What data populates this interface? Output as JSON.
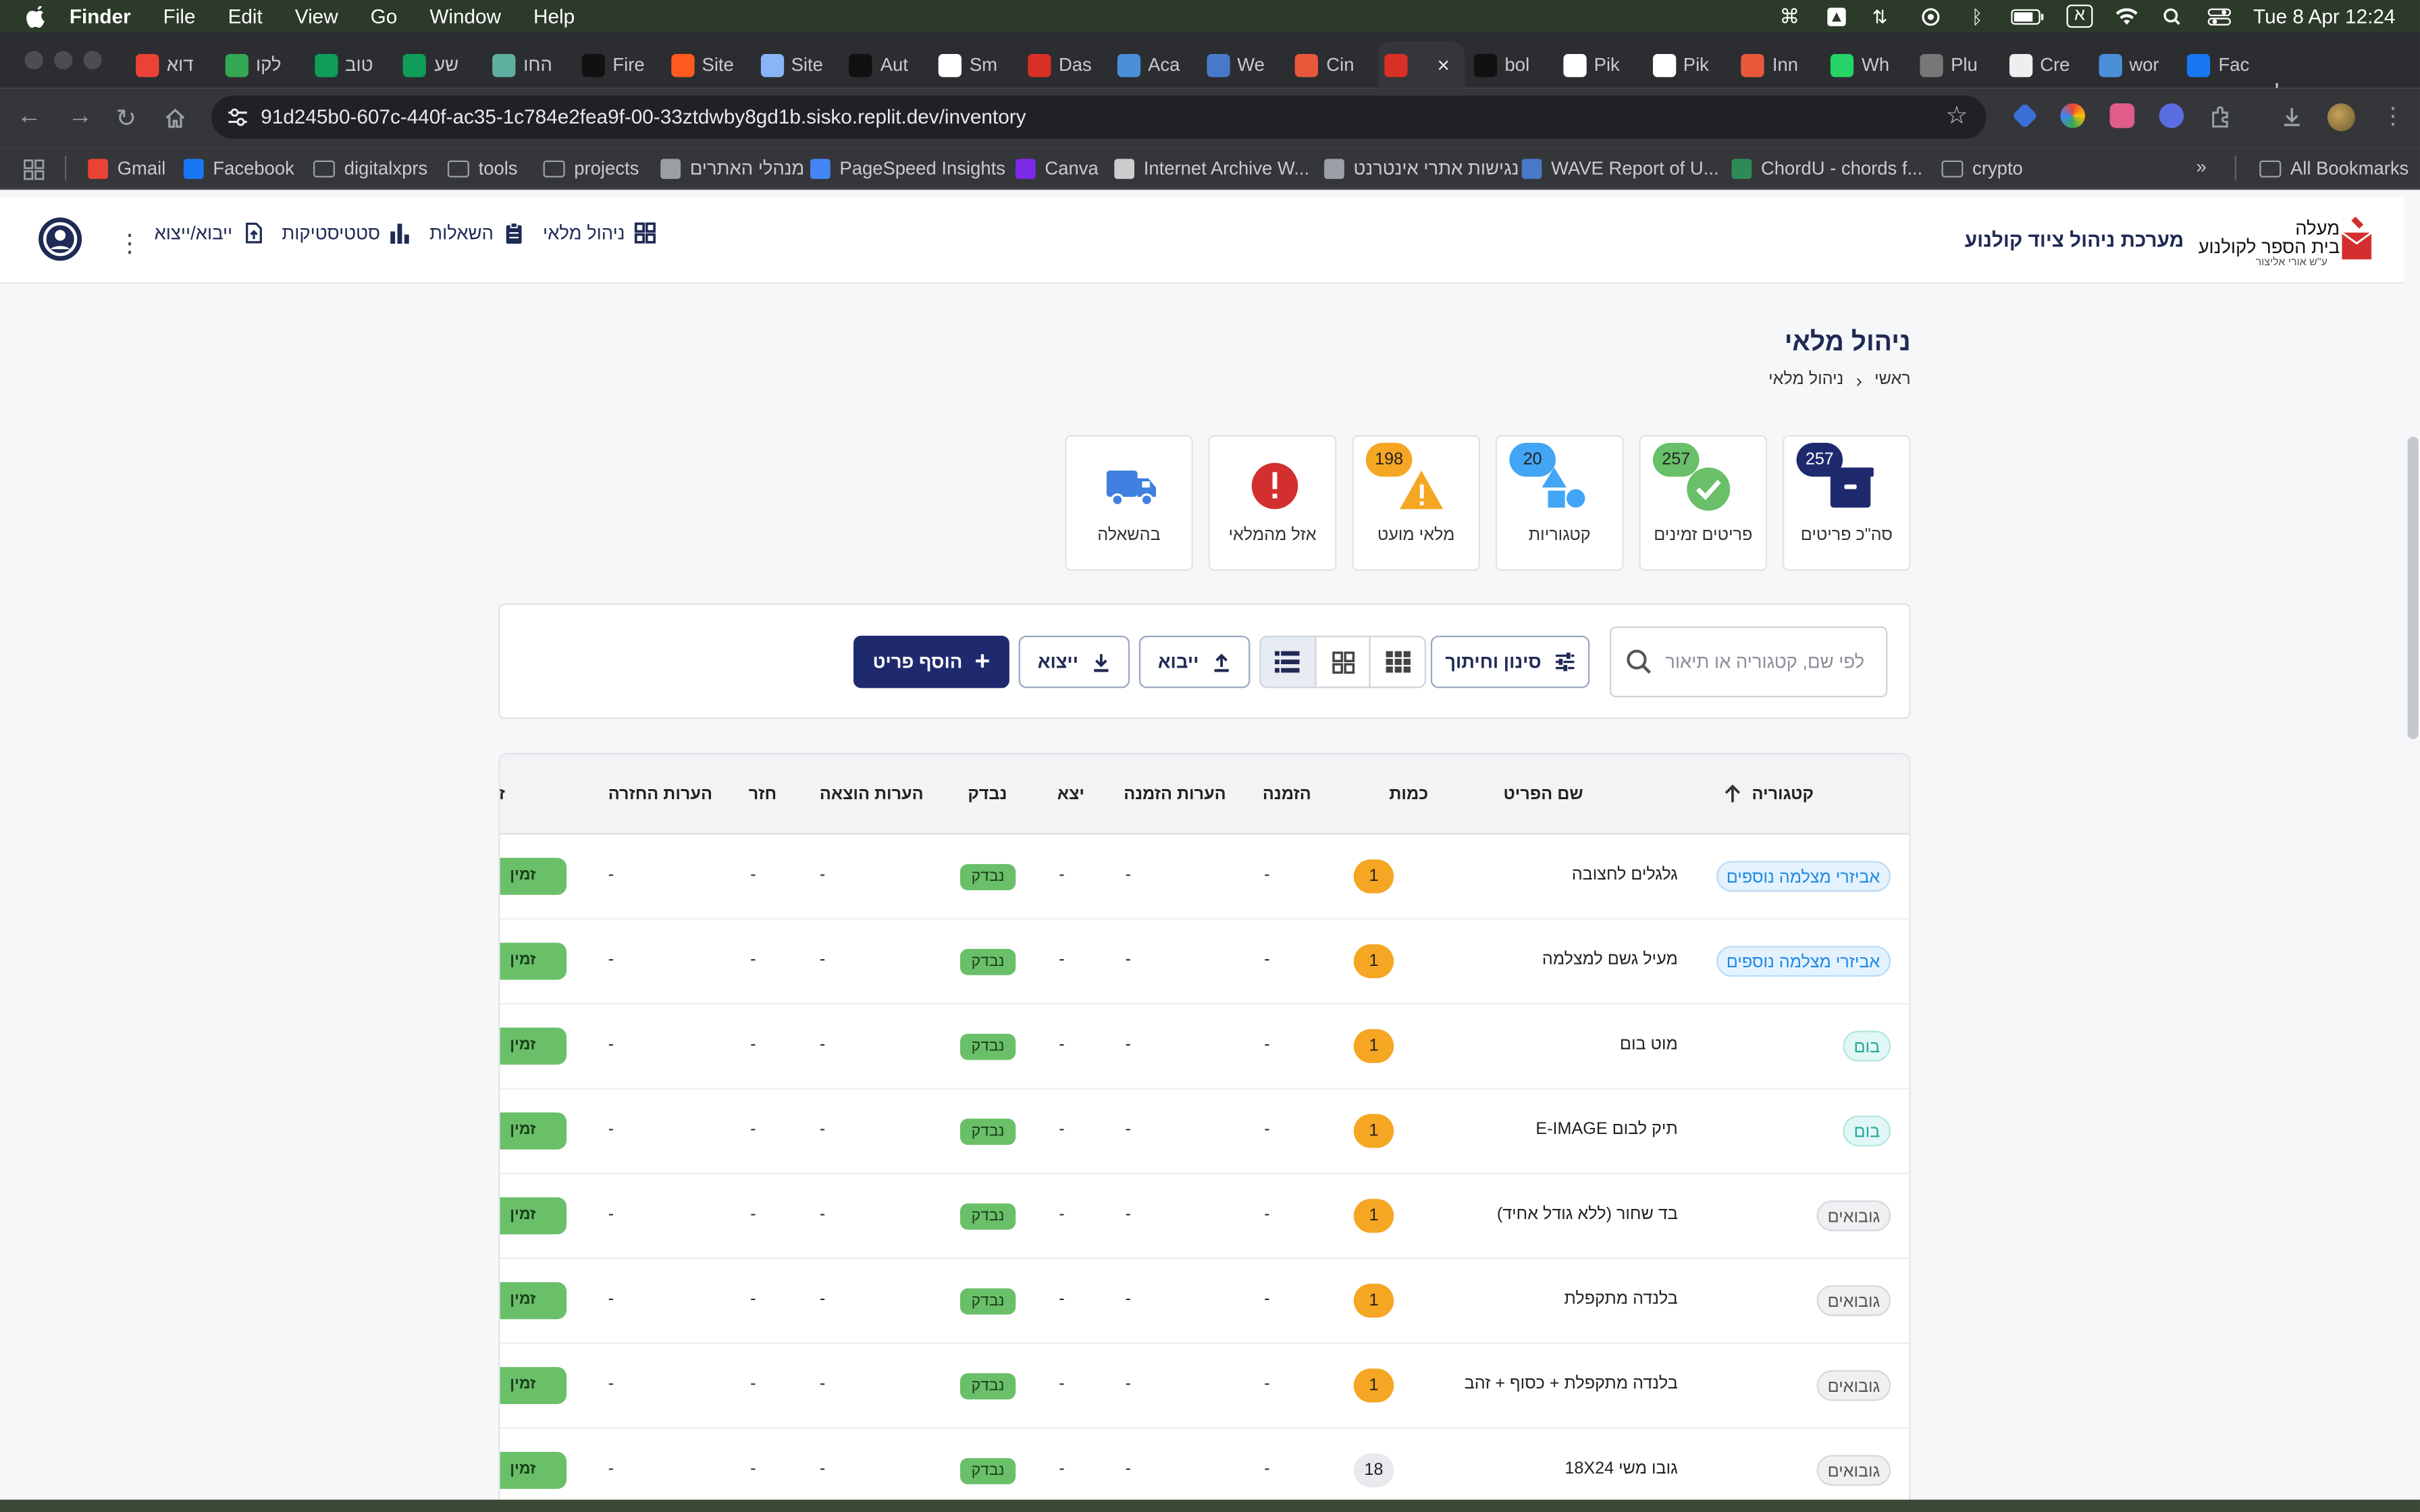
{
  "menubar": {
    "app": "Finder",
    "items": [
      "File",
      "Edit",
      "View",
      "Go",
      "Window",
      "Help"
    ],
    "clock": "Tue 8 Apr  12:24",
    "input_lang": "א"
  },
  "tabs": [
    {
      "label": "דוא",
      "color": "#ea4335"
    },
    {
      "label": "לקו",
      "color": "#34a853"
    },
    {
      "label": "טוב",
      "color": "#0f9d58"
    },
    {
      "label": "שע",
      "color": "#0f9d58"
    },
    {
      "label": "החו",
      "color": "#5fb0a0"
    },
    {
      "label": "Fire",
      "color": "#111111"
    },
    {
      "label": "Site",
      "color": "#ff5a1f"
    },
    {
      "label": "Site",
      "color": "#8ab4f8"
    },
    {
      "label": "Aut",
      "color": "#111111"
    },
    {
      "label": "Sm",
      "color": "#ffffff"
    },
    {
      "label": "Das",
      "color": "#d93025"
    },
    {
      "label": "Aca",
      "color": "#4a90d9"
    },
    {
      "label": "We",
      "color": "#4a78c9"
    },
    {
      "label": "Cin",
      "color": "#e8593c"
    },
    {
      "label": "",
      "color": "#d93025"
    },
    {
      "label": "bol",
      "color": "#111111"
    },
    {
      "label": "Pik",
      "color": "#ffffff"
    },
    {
      "label": "Pik",
      "color": "#ffffff"
    },
    {
      "label": "Inn",
      "color": "#e8593c"
    },
    {
      "label": "Wh",
      "color": "#25d366"
    },
    {
      "label": "Plu",
      "color": "#777777"
    },
    {
      "label": "Cre",
      "color": "#eeeeee"
    },
    {
      "label": "wor",
      "color": "#4a90d9"
    },
    {
      "label": "Fac",
      "color": "#1877f2"
    }
  ],
  "url": "91d245b0-607c-440f-ac35-1c784e2fea9f-00-33ztdwby8gd1b.sisko.replit.dev/inventory",
  "bookmarks": [
    {
      "label": "Gmail",
      "type": "icon",
      "color": "#ea4335"
    },
    {
      "label": "Facebook",
      "type": "icon",
      "color": "#1877f2"
    },
    {
      "label": "digitalxprs",
      "type": "folder"
    },
    {
      "label": "tools",
      "type": "folder"
    },
    {
      "label": "projects",
      "type": "folder"
    },
    {
      "label": "מנהלי האתרים",
      "type": "icon",
      "color": "#9aa0a6"
    },
    {
      "label": "PageSpeed Insights",
      "type": "icon",
      "color": "#4285f4"
    },
    {
      "label": "Canva",
      "type": "icon",
      "color": "#7d2ae8"
    },
    {
      "label": "Internet Archive W...",
      "type": "icon",
      "color": "#cccccc"
    },
    {
      "label": "נגישות אתרי אינטרנט",
      "type": "icon",
      "color": "#9aa0a6"
    },
    {
      "label": "WAVE Report of U...",
      "type": "icon",
      "color": "#4a78c9"
    },
    {
      "label": "ChordU - chords f...",
      "type": "icon",
      "color": "#2e8b57"
    },
    {
      "label": "crypto",
      "type": "folder"
    }
  ],
  "all_bookmarks": "All Bookmarks",
  "app": {
    "logo_line1": "מעלה",
    "logo_line2": "בית הספר לקולנוע",
    "logo_line3": "ע\"ש אורי אליצור",
    "title": "מערכת ניהול ציוד קולנוע",
    "nav": [
      {
        "label": "ניהול מלאי",
        "icon": "grid-icon"
      },
      {
        "label": "השאלות",
        "icon": "clipboard-icon"
      },
      {
        "label": "סטטיסטיקות",
        "icon": "bar-chart-icon"
      },
      {
        "label": "ייבוא/ייצוא",
        "icon": "upload-icon"
      }
    ],
    "page_title": "ניהול מלאי",
    "breadcrumb": [
      "ראשי",
      "ניהול מלאי"
    ],
    "cards": [
      {
        "label": "סה\"כ פריטים",
        "count": "257",
        "badge_color": "#1f2a6e",
        "icon": "archive-icon"
      },
      {
        "label": "פריטים זמינים",
        "count": "257",
        "badge_color": "#6abf69",
        "icon": "check-circle-icon"
      },
      {
        "label": "קטגוריות",
        "count": "20",
        "badge_color": "#42a5f5",
        "icon": "shapes-icon"
      },
      {
        "label": "מלאי מועט",
        "count": "198",
        "badge_color": "#f5a623",
        "icon": "warning-icon"
      },
      {
        "label": "אזל מהמלאי",
        "count": "",
        "badge_color": "",
        "icon": "error-icon"
      },
      {
        "label": "בהשאלה",
        "count": "",
        "badge_color": "",
        "icon": "truck-icon"
      }
    ],
    "search_placeholder": "לפי שם, קטגוריה או תיאור",
    "filter_label": "סינון וחיתוך",
    "import_label": "ייבוא",
    "export_label": "ייצוא",
    "add_label": "הוסף פריט",
    "columns": [
      "קטגוריה",
      "שם הפריט",
      "כמות",
      "הזמנה",
      "הערות הזמנה",
      "יצא",
      "נבדק",
      "הערות הוצאה",
      "חזר",
      "הערות החזרה",
      "זמינות"
    ],
    "rows": [
      {
        "category": "אביזרי מצלמה נוספים",
        "cat_style": "blue",
        "name": "גלגלים לחצובה",
        "qty": "1",
        "qty_style": "low",
        "order": "-",
        "order_notes": "-",
        "out": "-",
        "checked": "נבדק",
        "out_notes": "-",
        "returned": "-",
        "return_notes": "-",
        "status": "זמין"
      },
      {
        "category": "אביזרי מצלמה נוספים",
        "cat_style": "blue",
        "name": "מעיל גשם למצלמה",
        "qty": "1",
        "qty_style": "low",
        "order": "-",
        "order_notes": "-",
        "out": "-",
        "checked": "נבדק",
        "out_notes": "-",
        "returned": "-",
        "return_notes": "-",
        "status": "זמין"
      },
      {
        "category": "בום",
        "cat_style": "teal",
        "name": "מוט בום",
        "qty": "1",
        "qty_style": "low",
        "order": "-",
        "order_notes": "-",
        "out": "-",
        "checked": "נבדק",
        "out_notes": "-",
        "returned": "-",
        "return_notes": "-",
        "status": "זמין"
      },
      {
        "category": "בום",
        "cat_style": "teal",
        "name": "תיק לבום E-IMAGE",
        "qty": "1",
        "qty_style": "low",
        "order": "-",
        "order_notes": "-",
        "out": "-",
        "checked": "נבדק",
        "out_notes": "-",
        "returned": "-",
        "return_notes": "-",
        "status": "זמין"
      },
      {
        "category": "גובואים",
        "cat_style": "grey",
        "name": "בד שחור (ללא גודל אחיד)",
        "qty": "1",
        "qty_style": "low",
        "order": "-",
        "order_notes": "-",
        "out": "-",
        "checked": "נבדק",
        "out_notes": "-",
        "returned": "-",
        "return_notes": "-",
        "status": "זמין"
      },
      {
        "category": "גובואים",
        "cat_style": "grey",
        "name": "בלנדה מתקפלת",
        "qty": "1",
        "qty_style": "low",
        "order": "-",
        "order_notes": "-",
        "out": "-",
        "checked": "נבדק",
        "out_notes": "-",
        "returned": "-",
        "return_notes": "-",
        "status": "זמין"
      },
      {
        "category": "גובואים",
        "cat_style": "grey",
        "name": "בלנדה מתקפלת + כסוף + זהב",
        "qty": "1",
        "qty_style": "low",
        "order": "-",
        "order_notes": "-",
        "out": "-",
        "checked": "נבדק",
        "out_notes": "-",
        "returned": "-",
        "return_notes": "-",
        "status": "זמין"
      },
      {
        "category": "גובואים",
        "cat_style": "grey",
        "name": "גובו משי 18X24",
        "qty": "18",
        "qty_style": "ok",
        "order": "-",
        "order_notes": "-",
        "out": "-",
        "checked": "נבדק",
        "out_notes": "-",
        "returned": "-",
        "return_notes": "-",
        "status": "זמין"
      }
    ]
  },
  "colors": {
    "primary": "#1f2a6e",
    "success": "#6abf69",
    "warning": "#f5a623",
    "info": "#42a5f5",
    "danger": "#d32f2f",
    "truck": "#3f7fe0"
  }
}
